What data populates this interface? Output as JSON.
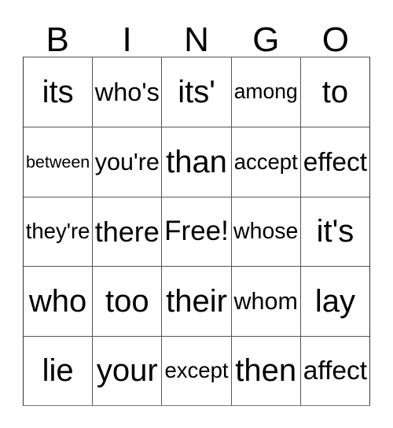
{
  "card": {
    "title": "BINGO",
    "header_letters": [
      "B",
      "I",
      "N",
      "G",
      "O"
    ],
    "free_space_label": "Free!",
    "free_space_position": {
      "row": 2,
      "column": 2
    },
    "grid_size": {
      "rows": 5,
      "columns": 5
    },
    "colors": {
      "background": "#ffffff",
      "text": "#000000",
      "border": "#555555"
    },
    "rows": [
      {
        "cells": [
          {
            "text": "its"
          },
          {
            "text": "who's"
          },
          {
            "text": "its'"
          },
          {
            "text": "among"
          },
          {
            "text": "to"
          }
        ]
      },
      {
        "cells": [
          {
            "text": "between"
          },
          {
            "text": "you're"
          },
          {
            "text": "than"
          },
          {
            "text": "accept"
          },
          {
            "text": "effect"
          }
        ]
      },
      {
        "cells": [
          {
            "text": "they're"
          },
          {
            "text": "there"
          },
          {
            "text": "Free!"
          },
          {
            "text": "whose"
          },
          {
            "text": "it's"
          }
        ]
      },
      {
        "cells": [
          {
            "text": "who"
          },
          {
            "text": "too"
          },
          {
            "text": "their"
          },
          {
            "text": "whom"
          },
          {
            "text": "lay"
          }
        ]
      },
      {
        "cells": [
          {
            "text": "lie"
          },
          {
            "text": "your"
          },
          {
            "text": "except"
          },
          {
            "text": "then"
          },
          {
            "text": "affect"
          }
        ]
      }
    ]
  }
}
